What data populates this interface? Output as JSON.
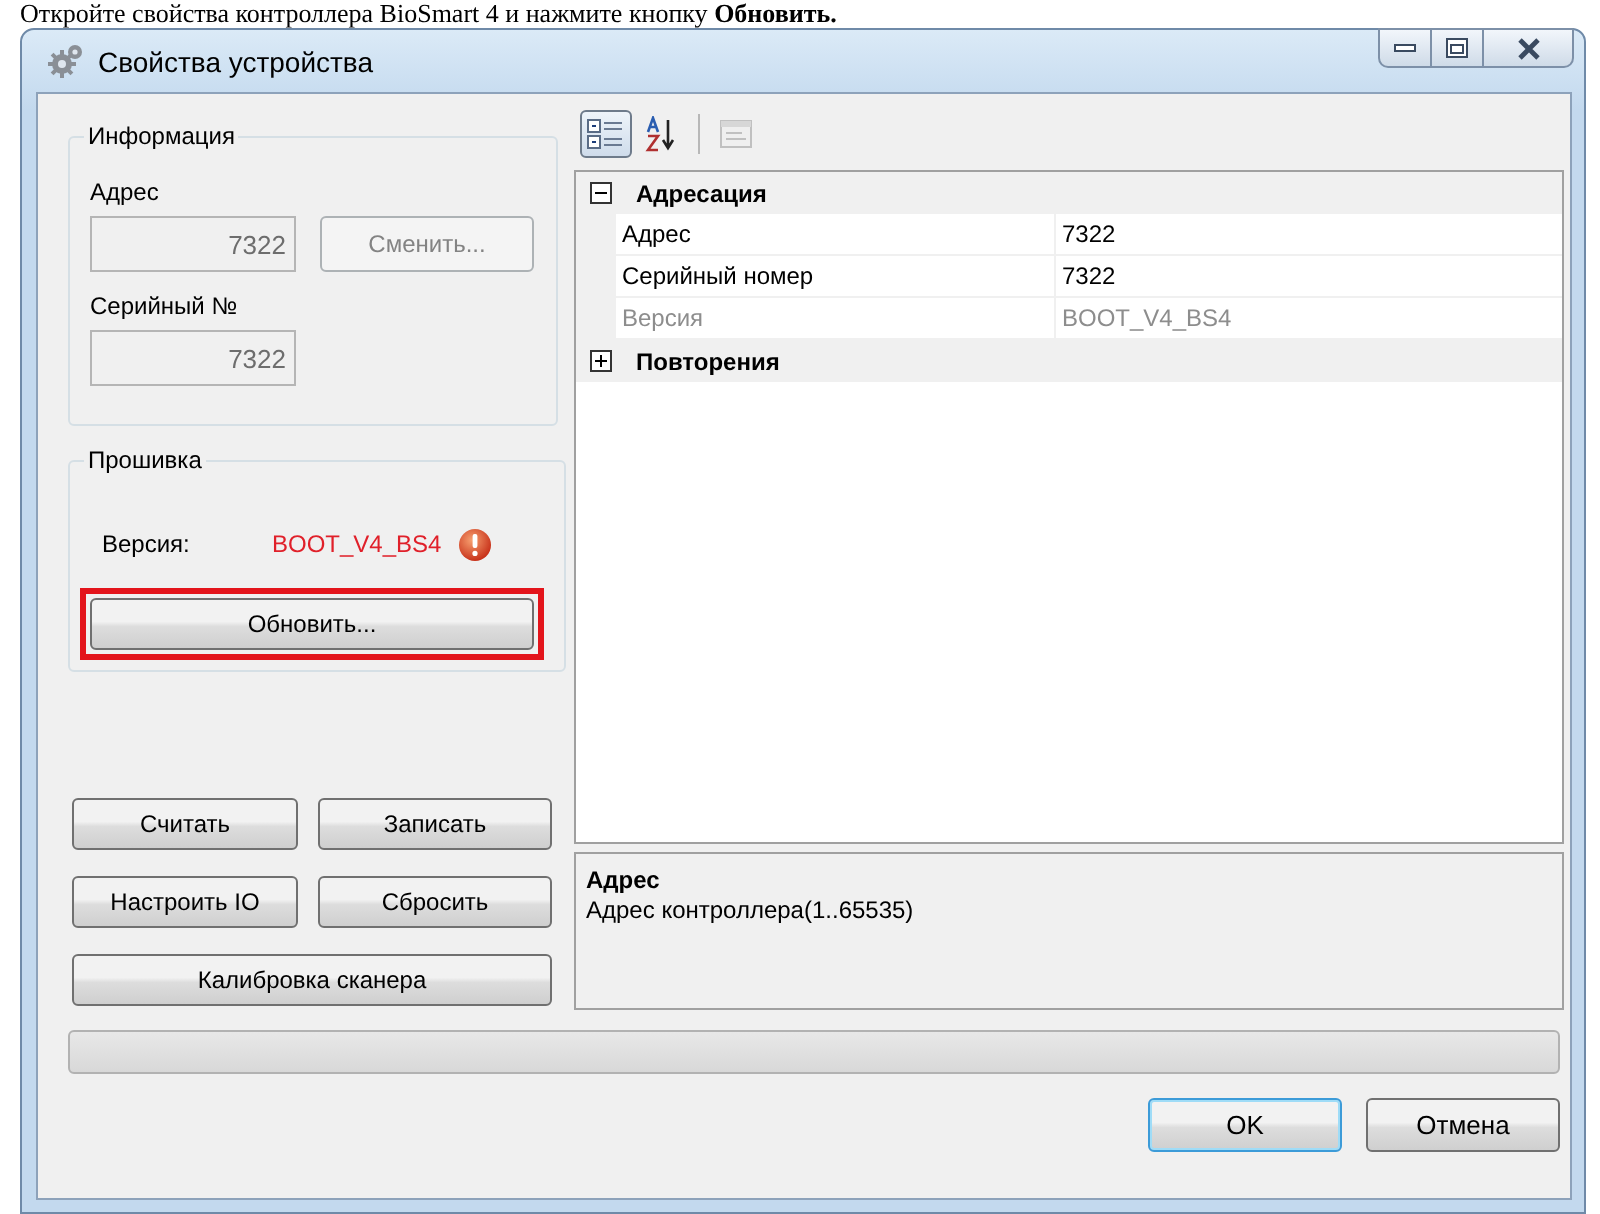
{
  "instruction": "Откройте свойства контроллера BioSmart 4 и нажмите кнопку **Обновить.**",
  "window": {
    "title": "Свойства устройства"
  },
  "info_group": {
    "title": "Информация",
    "address_label": "Адрес",
    "address_value": "7322",
    "change_button": {
      "label": "Сменить...",
      "disabled": true
    },
    "serial_label": "Серийный №",
    "serial_value": "7322"
  },
  "firmware_group": {
    "title": "Прошивка",
    "version_label": "Версия:",
    "version_value": "BOOT_V4_BS4",
    "warning": true,
    "update_button": {
      "label": "Обновить...",
      "highlighted": true
    }
  },
  "action_buttons": [
    {
      "label": "Считать",
      "wide": false
    },
    {
      "label": "Записать",
      "wide": false
    },
    {
      "label": "Настроить IO",
      "wide": false
    },
    {
      "label": "Сбросить",
      "wide": false
    },
    {
      "label": "Калибровка сканера",
      "wide": true
    }
  ],
  "property_grid": {
    "toolbar": [
      {
        "kind": "categorized",
        "selected": true,
        "disabled": false
      },
      {
        "kind": "alphabetical",
        "selected": false,
        "disabled": false
      },
      {
        "kind": "property-pages",
        "selected": false,
        "disabled": true
      }
    ],
    "categories": [
      {
        "name": "Адресация",
        "expanded": true,
        "properties": [
          {
            "name": "Адрес",
            "value": "7322",
            "readonly": false
          },
          {
            "name": "Серийный номер",
            "value": "7322",
            "readonly": false
          },
          {
            "name": "Версия",
            "value": "BOOT_V4_BS4",
            "readonly": true
          }
        ]
      },
      {
        "name": "Повторения",
        "expanded": false
      }
    ],
    "description": {
      "title": "Адрес",
      "text": "Адрес контроллера(1..65535)"
    }
  },
  "progress": {
    "level": 0
  },
  "dialog_buttons": [
    {
      "label": "OK",
      "default": true
    },
    {
      "label": "Отмена",
      "default": false
    }
  ]
}
